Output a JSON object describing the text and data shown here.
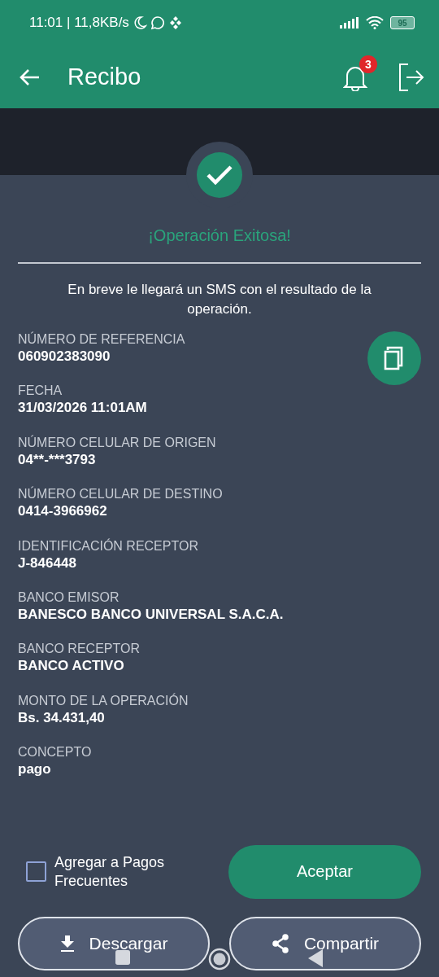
{
  "status_bar": {
    "time": "11:01 | 11,8KB/s",
    "battery": "95"
  },
  "app_bar": {
    "title": "Recibo",
    "notification_count": "3"
  },
  "result": {
    "title": "¡Operación Exitosa!",
    "message": "En breve le llegará un SMS con el resultado de la operación."
  },
  "fields": [
    {
      "label": "NÚMERO DE REFERENCIA",
      "value": "060902383090"
    },
    {
      "label": "FECHA",
      "value": "31/03/2026 11:01AM"
    },
    {
      "label": "NÚMERO CELULAR DE ORIGEN",
      "value": "04**-***3793"
    },
    {
      "label": "NÚMERO CELULAR DE DESTINO",
      "value": "0414-3966962"
    },
    {
      "label": "IDENTIFICACIÓN RECEPTOR",
      "value": "J-846448"
    },
    {
      "label": "BANCO EMISOR",
      "value": "BANESCO BANCO UNIVERSAL S.A.C.A."
    },
    {
      "label": "BANCO RECEPTOR",
      "value": "BANCO ACTIVO"
    },
    {
      "label": "MONTO DE LA OPERACIÓN",
      "value": "Bs. 34.431,40"
    },
    {
      "label": "CONCEPTO",
      "value": "pago"
    }
  ],
  "frequent_payment": {
    "label": "Agregar a Pagos Frecuentes",
    "checked": false
  },
  "accept_button": "Aceptar",
  "actions": [
    {
      "kind": "download",
      "label": "Descargar"
    },
    {
      "kind": "share",
      "label": "Compartir"
    }
  ]
}
